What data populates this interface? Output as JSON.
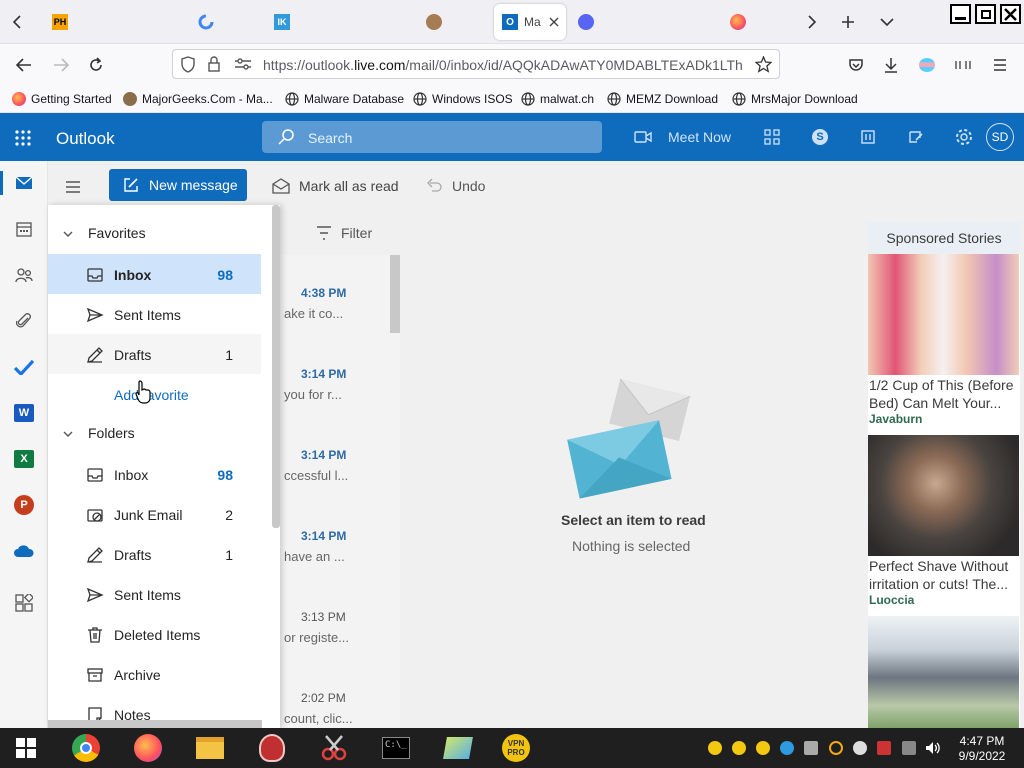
{
  "browser": {
    "active_tab_title": "Ma",
    "url_pre": "https://outlook.",
    "url_host": "live.com",
    "url_post": "/mail/0/inbox/id/AQQkADAwATY0MDABLTExADk1LTh",
    "bookmarks": [
      "Getting Started",
      "MajorGeeks.Com - Ma...",
      "Malware Database",
      "Windows ISOS",
      "malwat.ch",
      "MEMZ Download",
      "MrsMajor Download"
    ]
  },
  "outlook": {
    "app_title": "Outlook",
    "search_placeholder": "Search",
    "meet_now": "Meet Now",
    "avatar_initials": "SD",
    "commands": {
      "new_message": "New message",
      "mark_all_read": "Mark all as read",
      "undo": "Undo",
      "filter": "Filter"
    },
    "favorites": {
      "header": "Favorites",
      "items": [
        {
          "label": "Inbox",
          "count": "98"
        },
        {
          "label": "Sent Items",
          "count": ""
        },
        {
          "label": "Drafts",
          "count": "1"
        }
      ],
      "add_favorite": "Add favorite"
    },
    "folders": {
      "header": "Folders",
      "items": [
        {
          "label": "Inbox",
          "count": "98"
        },
        {
          "label": "Junk Email",
          "count": "2"
        },
        {
          "label": "Drafts",
          "count": "1"
        },
        {
          "label": "Sent Items",
          "count": ""
        },
        {
          "label": "Deleted Items",
          "count": ""
        },
        {
          "label": "Archive",
          "count": ""
        },
        {
          "label": "Notes",
          "count": ""
        }
      ]
    },
    "messages": [
      {
        "time": "4:38 PM",
        "preview": "ake it co...",
        "unread": true
      },
      {
        "time": "3:14 PM",
        "preview": "you for r...",
        "unread": true
      },
      {
        "time": "3:14 PM",
        "preview": "ccessful l...",
        "unread": true
      },
      {
        "time": "3:14 PM",
        "preview": "have an ...",
        "unread": true
      },
      {
        "time": "3:13 PM",
        "preview": "or registe...",
        "unread": false
      },
      {
        "time": "2:02 PM",
        "preview": "count, clic...",
        "unread": false
      }
    ],
    "reading_pane": {
      "title": "Select an item to read",
      "subtitle": "Nothing is selected"
    },
    "ads": {
      "header": "Sponsored Stories",
      "items": [
        {
          "text": "1/2 Cup of This (Before Bed) Can Melt Your...",
          "source": "Javaburn"
        },
        {
          "text": "Perfect Shave Without irritation or cuts! The...",
          "source": "Luoccia"
        }
      ]
    }
  },
  "taskbar": {
    "time": "4:47 PM",
    "date": "9/9/2022"
  },
  "colors": {
    "brand": "#0f6cbd",
    "selection": "#cfe4fa"
  }
}
